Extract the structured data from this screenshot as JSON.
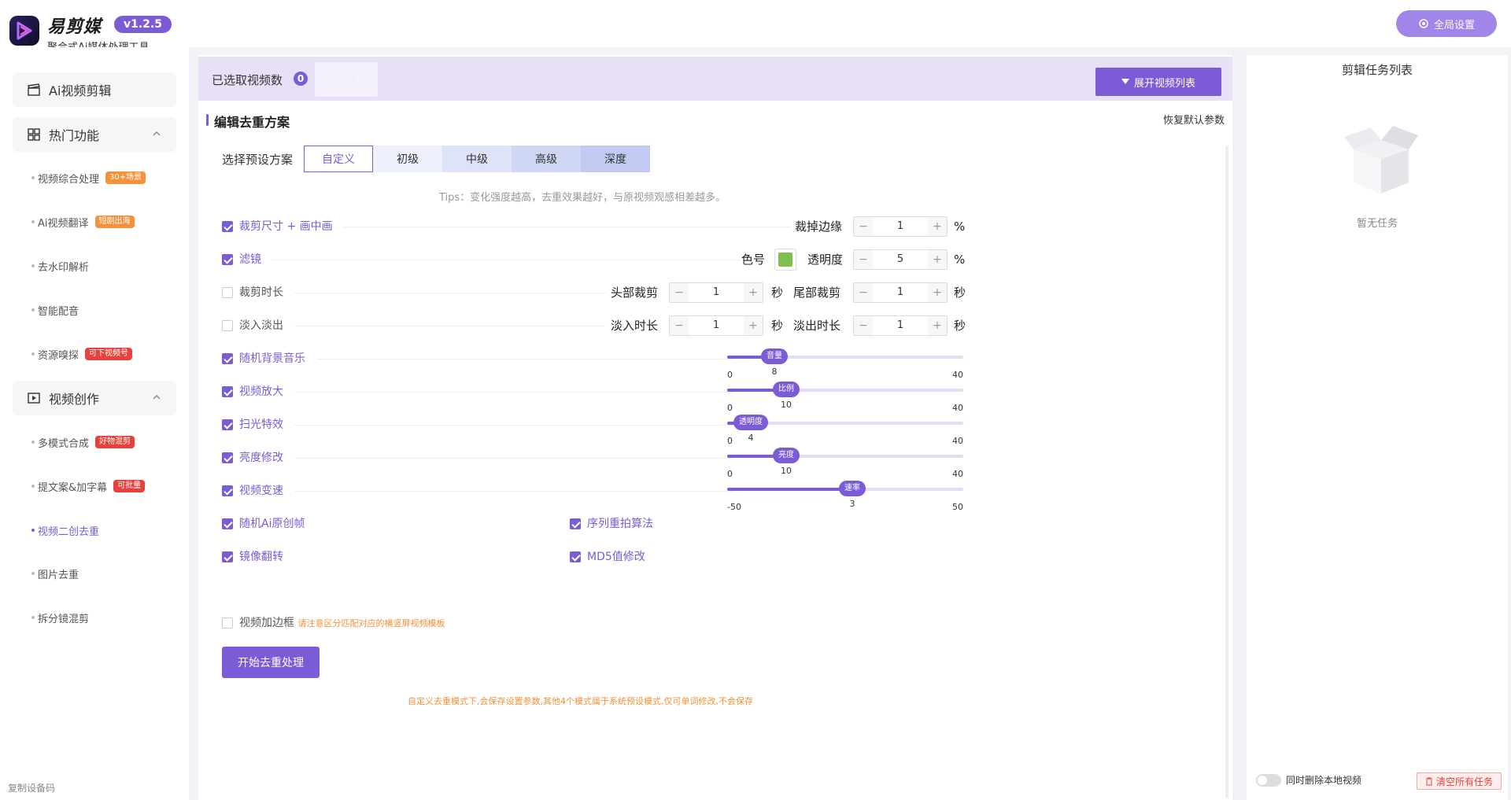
{
  "app": {
    "title": "易剪媒",
    "version": "v1.2.5",
    "subtitle": "聚合式Ai媒体处理工具",
    "global_settings": "全局设置"
  },
  "sidebar": {
    "groups": [
      {
        "label": "Ai视频剪辑"
      },
      {
        "label": "热门功能"
      },
      {
        "label": "视频创作"
      }
    ],
    "hot_items": [
      {
        "label": "视频综合处理",
        "tag": "30+场景"
      },
      {
        "label": "Ai视频翻译",
        "tag": "短剧出海"
      },
      {
        "label": "去水印解析",
        "tag": ""
      },
      {
        "label": "智能配音",
        "tag": ""
      },
      {
        "label": "资源嗅探",
        "tag": "可下视频号"
      }
    ],
    "create_items": [
      {
        "label": "多模式合成",
        "tag": "好物混剪"
      },
      {
        "label": "提文案&加字幕",
        "tag": "可批量"
      },
      {
        "label": "视频二创去重",
        "tag": ""
      },
      {
        "label": "图片去重",
        "tag": ""
      },
      {
        "label": "拆分镜混剪",
        "tag": ""
      }
    ],
    "device_code": "复制设备码"
  },
  "selection": {
    "label": "已选取视频数",
    "count": "0",
    "dots": "· · ·",
    "expand_btn": "展开视频列表"
  },
  "editor": {
    "heading": "编辑去重方案",
    "restore": "恢复默认参数",
    "preset_label": "选择预设方案",
    "presets": [
      "自定义",
      "初级",
      "中级",
      "高级",
      "深度"
    ],
    "tips": "Tips：变化强度越高，去重效果越好，与原视频观感相差越多。",
    "options": {
      "crop_size": "裁剪尺寸 + 画中画",
      "filter": "滤镜",
      "crop_duration": "裁剪时长",
      "fade": "淡入淡出",
      "bg_music": "随机背景音乐",
      "zoom": "视频放大",
      "sweep": "扫光特效",
      "brightness": "亮度修改",
      "speed": "视频变速",
      "ai_frame": "随机Ai原创帧",
      "seq_shoot": "序列重拍算法",
      "mirror": "镜像翻转",
      "md5": "MD5值修改",
      "frame_border": "视频加边框"
    },
    "controls": {
      "crop_edge_label": "裁掉边缘",
      "crop_edge_value": "1",
      "percent": "%",
      "color_label": "色号",
      "opacity_label": "透明度",
      "opacity_value": "5",
      "head_cut_label": "头部裁剪",
      "head_cut_value": "1",
      "tail_cut_label": "尾部裁剪",
      "tail_cut_value": "1",
      "fade_in_label": "淡入时长",
      "fade_in_value": "1",
      "fade_out_label": "淡出时长",
      "fade_out_value": "1",
      "sec": "秒",
      "minus": "−",
      "plus": "+"
    },
    "sliders": [
      {
        "name": "音量",
        "value": 8,
        "min": 0,
        "max": 40,
        "min_label": "0",
        "max_label": "40",
        "value_label": "8"
      },
      {
        "name": "比例",
        "value": 10,
        "min": 0,
        "max": 40,
        "min_label": "0",
        "max_label": "40",
        "value_label": "10"
      },
      {
        "name": "透明度",
        "value": 4,
        "min": 0,
        "max": 40,
        "min_label": "0",
        "max_label": "40",
        "value_label": "4"
      },
      {
        "name": "亮度",
        "value": 10,
        "min": 0,
        "max": 40,
        "min_label": "0",
        "max_label": "40",
        "value_label": "10"
      },
      {
        "name": "速率",
        "value": 3,
        "min": -50,
        "max": 50,
        "min_label": "-50",
        "max_label": "50",
        "value_label": "3"
      }
    ],
    "frame_note": "请注意区分匹配对应的横竖屏视频模板",
    "start_btn": "开始去重处理",
    "footer_note": "自定义去重模式下,会保存设置参数,其他4个模式属于系统预设模式,仅可单词修改,不会保存"
  },
  "task_panel": {
    "title": "剪辑任务列表",
    "empty": "暂无任务",
    "delete_local": "同时删除本地视频",
    "clear_all": "清空所有任务"
  },
  "colors": {
    "accent": "#7b5cd6",
    "filter_swatch": "#7dc04b",
    "warning": "#f5913a",
    "danger": "#e8403b"
  }
}
